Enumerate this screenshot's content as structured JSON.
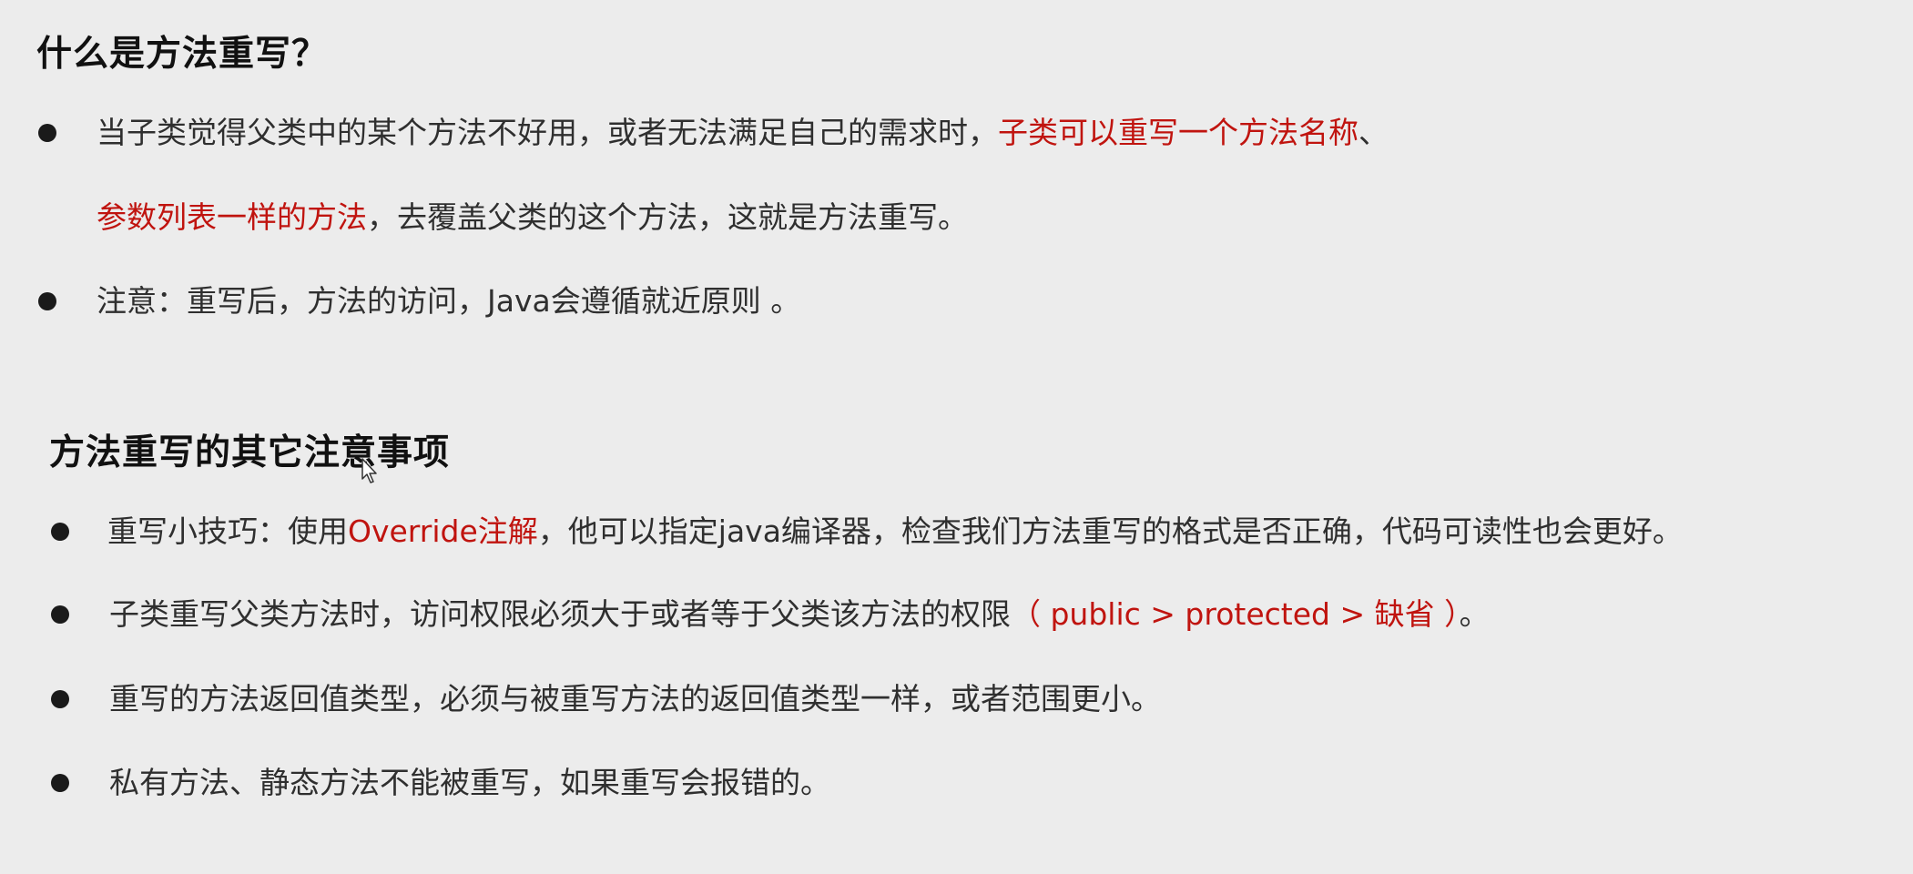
{
  "colors": {
    "background": "#ececec",
    "text": "#2f2f2f",
    "heading": "#111111",
    "highlight": "#c0140f"
  },
  "section1": {
    "heading": "什么是方法重写？",
    "items": [
      {
        "line1_pre": "当子类觉得父类中的某个方法不好用，或者无法满足自己的需求时，",
        "line1_red": "子类可以重写一个方法名称",
        "line1_post": "、",
        "line2_red": "参数列表一样的方法",
        "line2_post": "，去覆盖父类的这个方法，这就是方法重写。"
      },
      {
        "text": "注意：重写后，方法的访问，Java会遵循就近原则 。"
      }
    ]
  },
  "section2": {
    "heading": "方法重写的其它注意事项",
    "items": [
      {
        "pre": "重写小技巧：使用",
        "red": "Override注解",
        "post": "，他可以指定java编译器，检查我们方法重写的格式是否正确，代码可读性也会更好。"
      },
      {
        "pre": "子类重写父类方法时，访问权限必须大于或者等于父类该方法的权限",
        "red": "（ public > protected > 缺省 ）",
        "post": "。"
      },
      {
        "text": "重写的方法返回值类型，必须与被重写方法的返回值类型一样，或者范围更小。"
      },
      {
        "text": "私有方法、静态方法不能被重写，如果重写会报错的。"
      }
    ]
  },
  "icons": {
    "bullet": "bullet-dot",
    "cursor": "mouse-pointer-icon"
  }
}
